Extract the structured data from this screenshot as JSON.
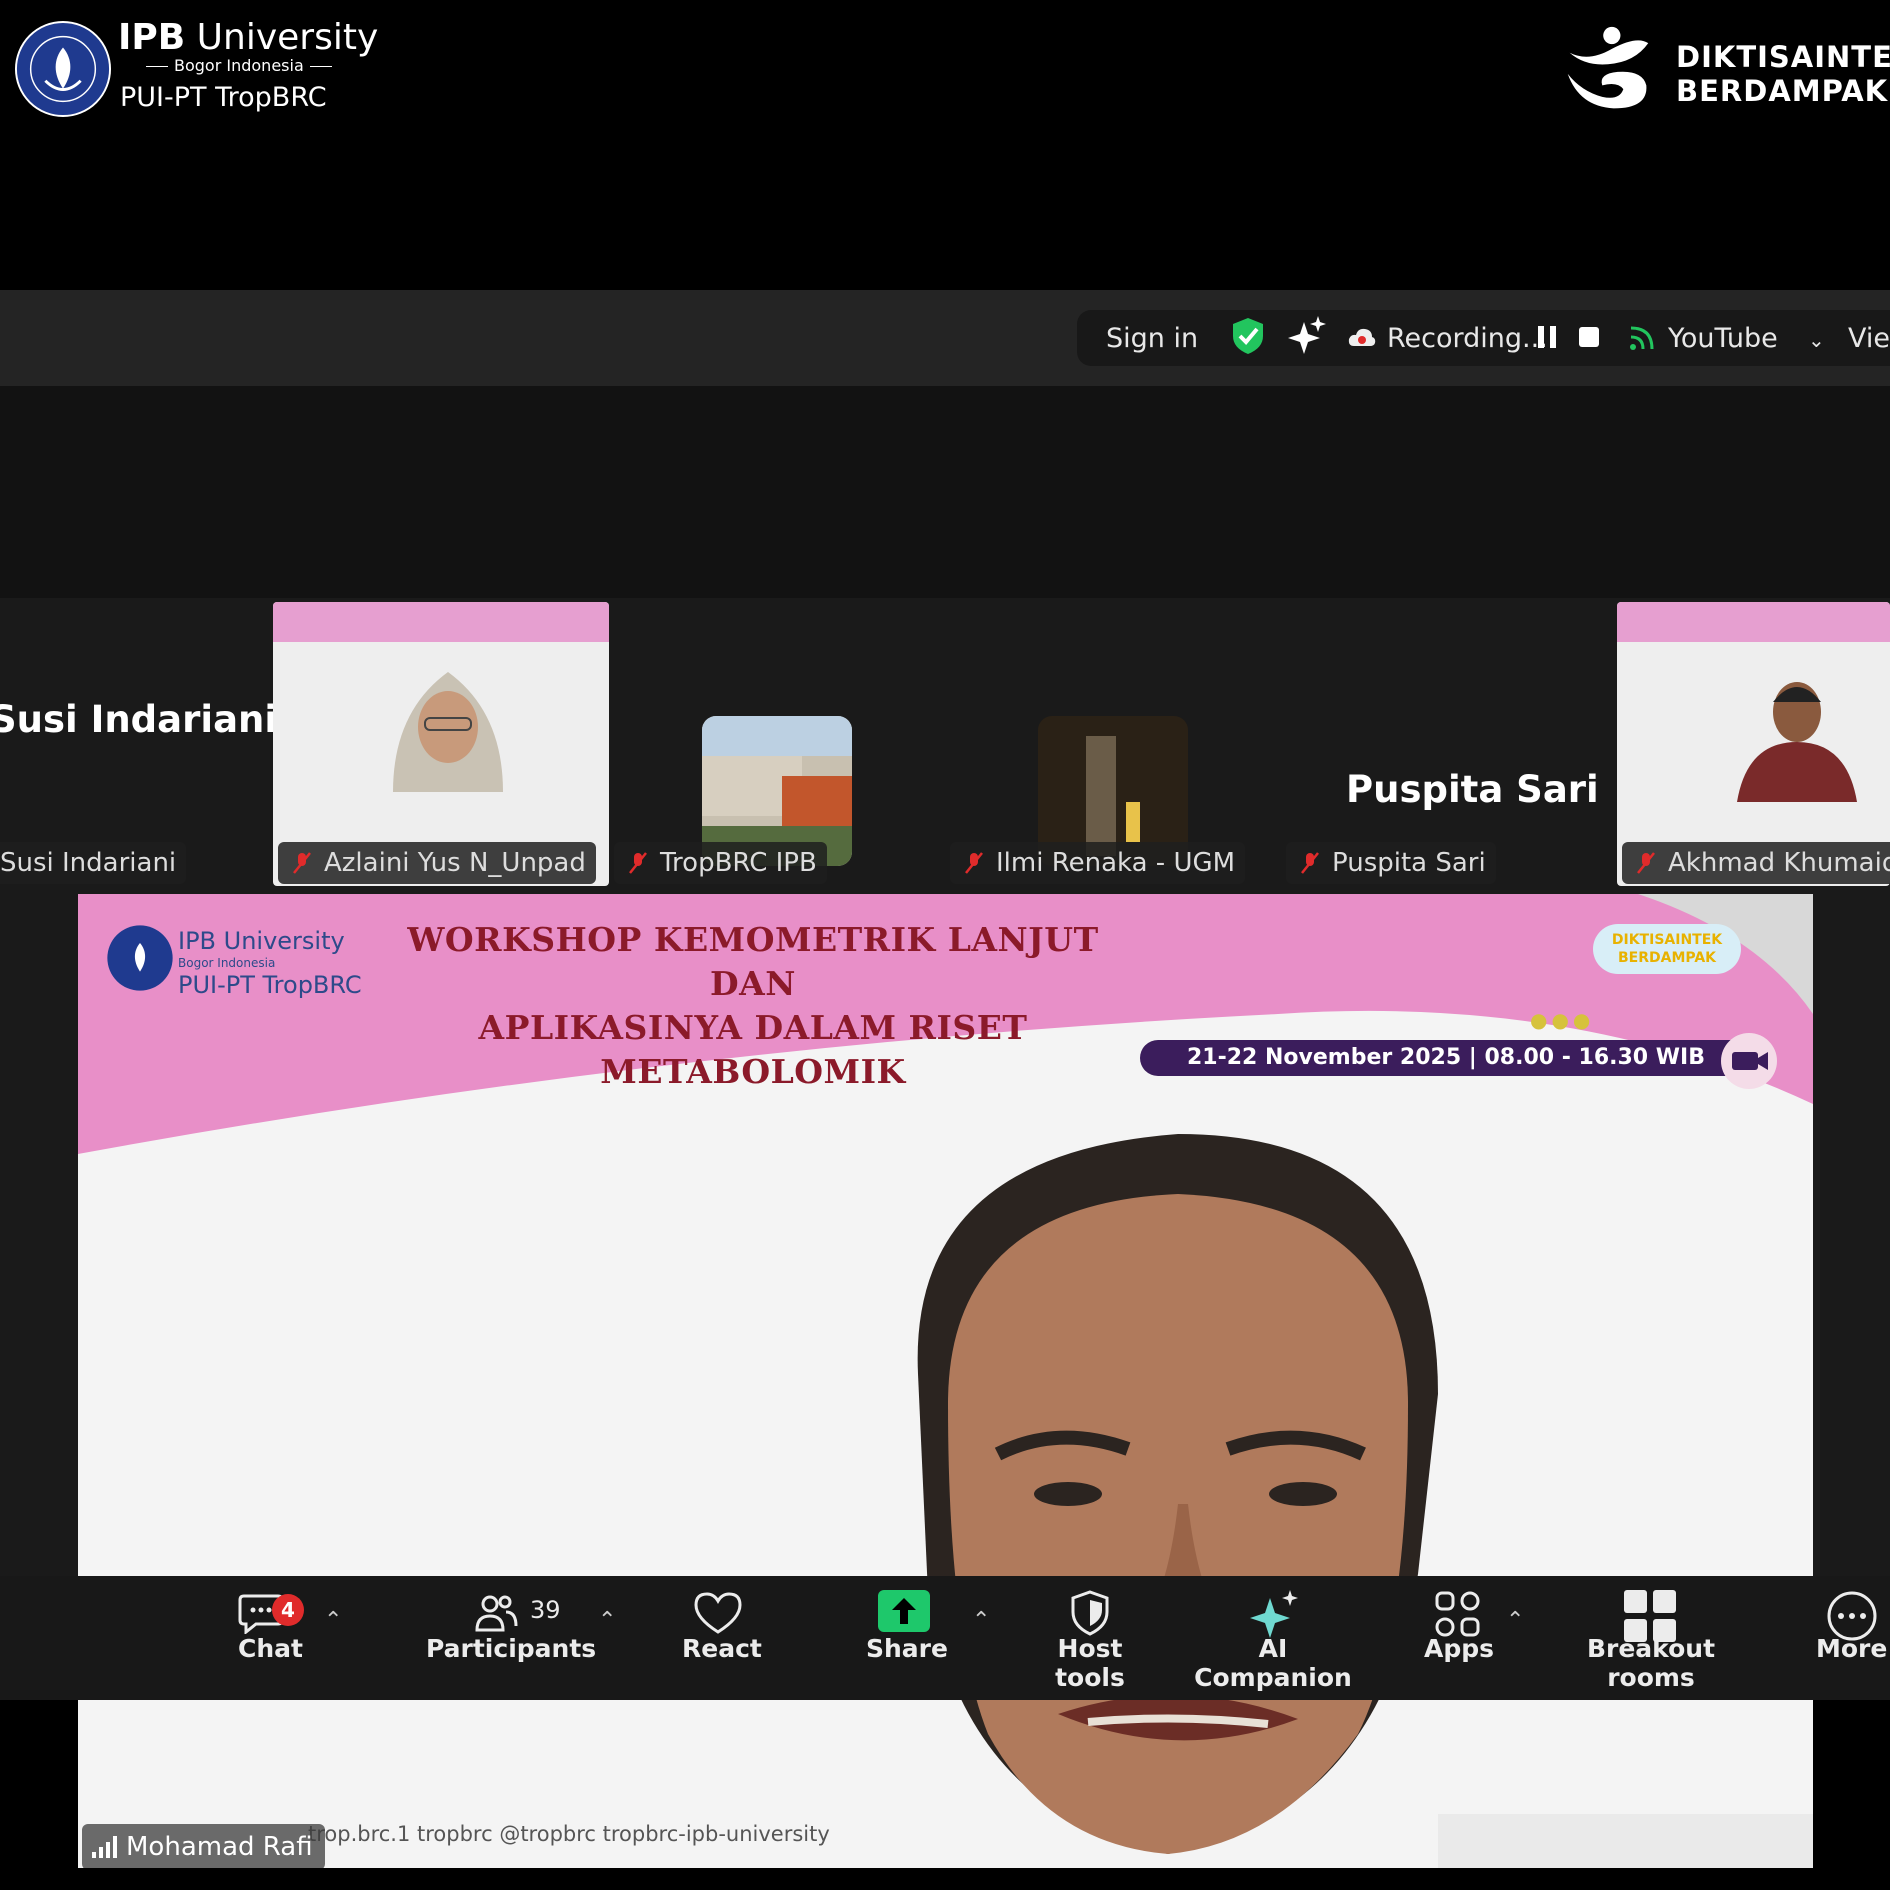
{
  "branding": {
    "ipb_name_bold": "IPB",
    "ipb_name_rest": " University",
    "ipb_sub": "Bogor Indonesia",
    "ipb_unit": "PUI-PT TropBRC",
    "dikti_line1": "DIKTISAINTEK",
    "dikti_line2": "BERDAMPAK"
  },
  "topbar": {
    "sign_in": "Sign in",
    "recording": "Recording...",
    "youtube": "YouTube",
    "view": "View"
  },
  "participants_strip": [
    {
      "big_name": "Susi Indariani",
      "tag": "Susi Indariani"
    },
    {
      "tag": "Azlaini Yus N_Unpad"
    },
    {
      "tag": "TropBRC IPB"
    },
    {
      "tag": "Ilmi Renaka - UGM"
    },
    {
      "big_name": "Puspita Sari",
      "tag": "Puspita Sari"
    },
    {
      "tag": "Akhmad Khumaidi_"
    }
  ],
  "main_share": {
    "title_line1": "WORKSHOP KEMOMETRIK LANJUT DAN",
    "title_line2": "APLIKASINYA DALAM RISET METABOLOMIK",
    "date": "21-22 November 2025 | 08.00 - 16.30 WIB",
    "ipb_line1": "IPB University",
    "ipb_line2": "Bogor Indonesia",
    "ipb_line3": "PUI-PT TropBRC",
    "dikti_badge_1": "DIKTISAINTEK",
    "dikti_badge_2": "BERDAMPAK",
    "socials": "trop.brc.1   tropbrc   @tropbrc   tropbrc-ipb-university",
    "speaker": "Mohamad Rafi"
  },
  "toolbar": {
    "chat": "Chat",
    "chat_badge": "4",
    "participants": "Participants",
    "participants_count": "39",
    "react": "React",
    "share": "Share",
    "host_tools": "Host tools",
    "ai_companion": "AI Companion",
    "apps": "Apps",
    "breakout": "Breakout rooms",
    "more": "More"
  },
  "colors": {
    "banner_pink": "#e88fc8",
    "share_green": "#1ec86b",
    "badge_red": "#e02b2b",
    "shield_green": "#22c55e"
  }
}
